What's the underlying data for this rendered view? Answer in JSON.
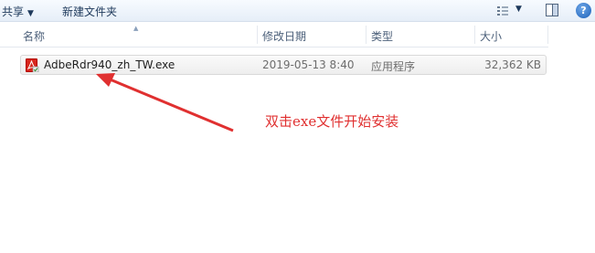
{
  "toolbar": {
    "share_label": "共享",
    "share_arrow": "▼",
    "new_folder_label": "新建文件夹",
    "views_arrow": "▼",
    "help_label": "?"
  },
  "columns": {
    "name": "名称",
    "date": "修改日期",
    "type": "类型",
    "size": "大小",
    "sort_indicator": "▲"
  },
  "files": [
    {
      "name": "AdbeRdr940_zh_TW.exe",
      "modified": "2019-05-13 8:40",
      "type": "应用程序",
      "size": "32,362 KB",
      "icon": "adobe-reader-icon"
    }
  ],
  "annotation": {
    "text": "双击exe文件开始安装",
    "color": "#e03030"
  }
}
